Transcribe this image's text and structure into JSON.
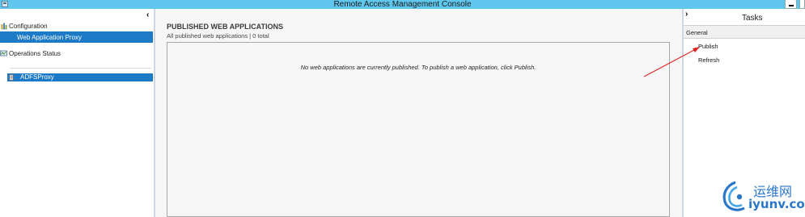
{
  "window": {
    "title": "Remote Access Management Console",
    "colors": {
      "titlebar": "#5fc7ee",
      "selection": "#1c7ac7"
    }
  },
  "nav": {
    "collapse_glyph": "‹",
    "configuration_label": "Configuration",
    "web_app_proxy_label": "Web Application Proxy",
    "operations_status_label": "Operations Status",
    "server_label": "ADFSProxy"
  },
  "main": {
    "heading": "PUBLISHED WEB APPLICATIONS",
    "subtitle": "All published web applications | 0 total",
    "empty_message": "No web applications are currently published. To publish a web application, click Publish."
  },
  "tasks": {
    "expand_glyph": "›",
    "title": "Tasks",
    "group_header": "General",
    "actions": [
      {
        "label": "Publish"
      },
      {
        "label": "Refresh"
      }
    ]
  },
  "watermark": {
    "cn": "运维网",
    "en": "iyunv.com"
  }
}
